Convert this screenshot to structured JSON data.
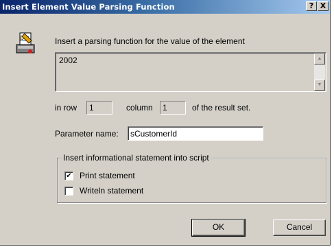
{
  "window": {
    "title": "Insert Element Value Parsing Function",
    "help_label": "?",
    "close_label": "X",
    "titlebar_color": "#0a246a"
  },
  "description": "Insert a parsing function for the value of the element",
  "element_value": "2002",
  "location": {
    "in_row_label": "in row",
    "row_value": "1",
    "column_label": "column",
    "column_value": "1",
    "suffix_label": "of the result set."
  },
  "parameter": {
    "label": "Parameter name:",
    "value": "sCustomerId"
  },
  "group": {
    "title": "Insert informational statement into script",
    "options": [
      {
        "label": "Print statement",
        "checked": true
      },
      {
        "label": "Writeln statement",
        "checked": false
      }
    ]
  },
  "buttons": {
    "ok_label": "OK",
    "cancel_label": "Cancel"
  },
  "icons": {
    "app": "form-insert-icon",
    "scroll_up": "triangle-up-icon",
    "scroll_down": "triangle-down-icon"
  }
}
